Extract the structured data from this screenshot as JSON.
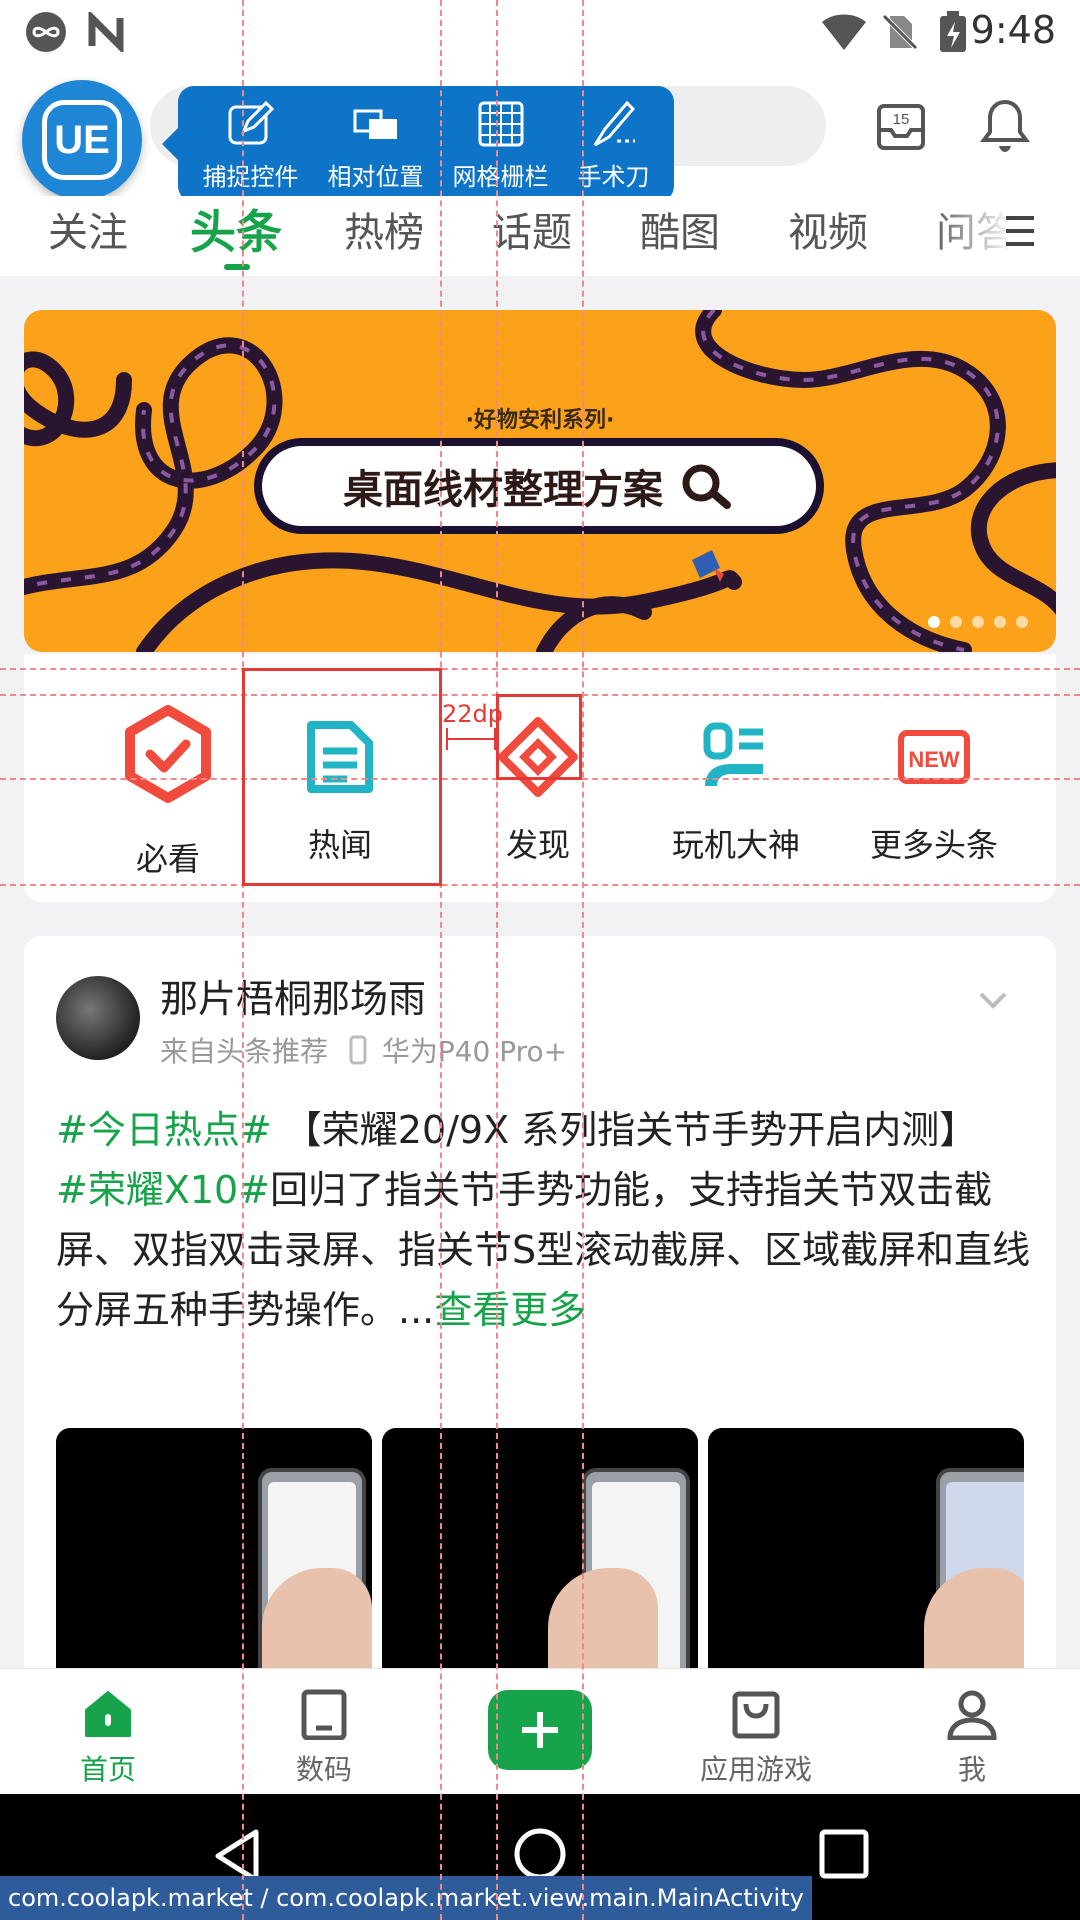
{
  "status_bar": {
    "time": "9:48"
  },
  "top_bar": {
    "calendar_day": "15"
  },
  "ue_toolbar": {
    "badge": "UE",
    "tools": [
      {
        "label": "捕捉控件",
        "icon": "pencil-square-icon"
      },
      {
        "label": "相对位置",
        "icon": "stacked-rectangles-icon"
      },
      {
        "label": "网格栅栏",
        "icon": "grid-icon"
      },
      {
        "label": "手术刀",
        "icon": "scalpel-icon"
      }
    ]
  },
  "tabs": [
    "关注",
    "头条",
    "热榜",
    "话题",
    "酷图",
    "视频",
    "问答"
  ],
  "active_tab": "头条",
  "banner": {
    "subtitle": "·好物安利系列·",
    "title": "桌面线材整理方案",
    "dots": 5,
    "active_dot": 0,
    "bg_color": "#fca21a"
  },
  "quick_entries": [
    {
      "label": "必看",
      "icon": "check-hexagon-icon",
      "color": "#f04b3c"
    },
    {
      "label": "热闻",
      "icon": "document-icon",
      "color": "#20b4c4"
    },
    {
      "label": "发现",
      "icon": "diamond-compass-icon",
      "color": "#f04b3c"
    },
    {
      "label": "玩机大神",
      "icon": "user-badge-icon",
      "color": "#20b4c4"
    },
    {
      "label": "更多头条",
      "icon": "new-badge-icon",
      "color": "#f04b3c"
    }
  ],
  "measure_label": "22dp",
  "feed": {
    "username": "那片梧桐那场雨",
    "source": "来自头条推荐",
    "device": "华为P40 Pro+",
    "tag1": "#今日热点#",
    "line1": " 【荣耀20/9X 系列指关节手势开启内测】",
    "tag2": "#荣耀X10#",
    "body": "回归了指关节手势功能，支持指关节双击截屏、双指双击录屏、指关节S型滚动截屏、区域截屏和直线分屏五种手势操作。...",
    "more": "查看更多"
  },
  "bottom_nav": [
    {
      "label": "首页",
      "icon": "home-icon",
      "active": true
    },
    {
      "label": "数码",
      "icon": "tablet-icon",
      "active": false
    },
    {
      "label": "应用游戏",
      "icon": "bag-icon",
      "active": false
    },
    {
      "label": "我",
      "icon": "person-icon",
      "active": false
    }
  ],
  "package_label": "com.coolapk.market / com.coolapk.market.view.main.MainActivity",
  "accent_color": "#17a34a"
}
